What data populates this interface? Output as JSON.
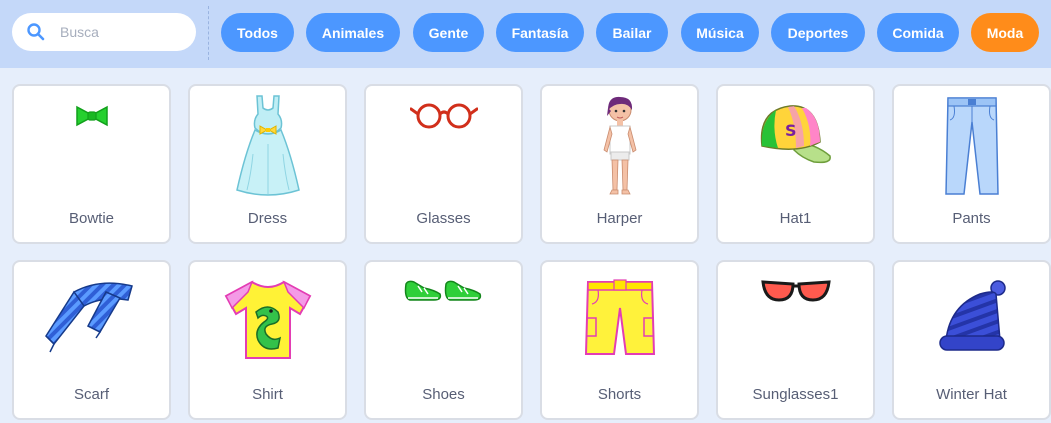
{
  "search": {
    "placeholder": "Busca"
  },
  "tags": [
    "Todos",
    "Animales",
    "Gente",
    "Fantasía",
    "Bailar",
    "Música",
    "Deportes",
    "Comida",
    "Moda"
  ],
  "active_tag": "Moda",
  "items": [
    {
      "name": "Bowtie",
      "icon": "bowtie-icon"
    },
    {
      "name": "Dress",
      "icon": "dress-icon"
    },
    {
      "name": "Glasses",
      "icon": "glasses-icon"
    },
    {
      "name": "Harper",
      "icon": "harper-person-icon"
    },
    {
      "name": "Hat1",
      "icon": "cap-icon"
    },
    {
      "name": "Pants",
      "icon": "pants-icon"
    },
    {
      "name": "Scarf",
      "icon": "scarf-icon"
    },
    {
      "name": "Shirt",
      "icon": "shirt-icon"
    },
    {
      "name": "Shoes",
      "icon": "shoes-icon"
    },
    {
      "name": "Shorts",
      "icon": "shorts-icon"
    },
    {
      "name": "Sunglasses1",
      "icon": "sunglasses-icon"
    },
    {
      "name": "Winter Hat",
      "icon": "winter-hat-icon"
    }
  ],
  "colors": {
    "tag": "#4c97ff",
    "tag_active": "#ff8c1a",
    "topbar": "#c4d8f9",
    "background": "#e6eefb",
    "label": "#575e75"
  }
}
